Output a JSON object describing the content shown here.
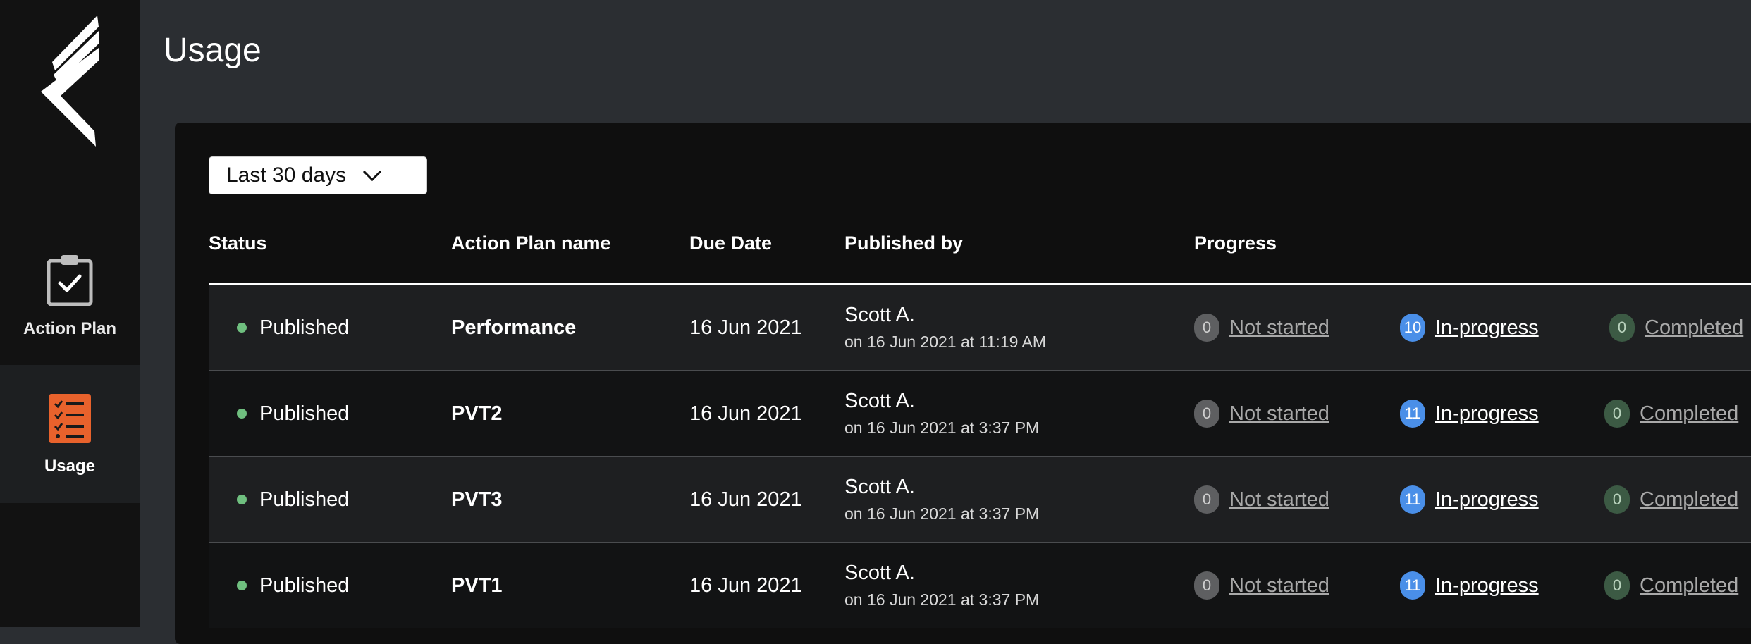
{
  "sidebar": {
    "logo_icon": "brand-logo",
    "items": [
      {
        "label": "Action Plan",
        "icon": "clipboard-check-icon",
        "active": false
      },
      {
        "label": "Usage",
        "icon": "checklist-icon",
        "active": true
      }
    ]
  },
  "header": {
    "title": "Usage"
  },
  "filter": {
    "selected": "Last 30 days"
  },
  "table": {
    "columns": [
      "Status",
      "Action Plan name",
      "Due Date",
      "Published by",
      "Progress"
    ],
    "rows": [
      {
        "status": "Published",
        "name": "Performance",
        "due": "16 Jun 2021",
        "published_by": "Scott A.",
        "published_on": "on 16 Jun 2021 at 11:19 AM",
        "not_started_count": "0",
        "not_started_label": "Not started",
        "in_progress_count": "10",
        "in_progress_label": "In-progress",
        "completed_count": "0",
        "completed_label": "Completed"
      },
      {
        "status": "Published",
        "name": "PVT2",
        "due": "16 Jun 2021",
        "published_by": "Scott A.",
        "published_on": "on 16 Jun 2021 at 3:37 PM",
        "not_started_count": "0",
        "not_started_label": "Not started",
        "in_progress_count": "11",
        "in_progress_label": "In-progress",
        "completed_count": "0",
        "completed_label": "Completed"
      },
      {
        "status": "Published",
        "name": "PVT3",
        "due": "16 Jun 2021",
        "published_by": "Scott A.",
        "published_on": "on 16 Jun 2021 at 3:37 PM",
        "not_started_count": "0",
        "not_started_label": "Not started",
        "in_progress_count": "11",
        "in_progress_label": "In-progress",
        "completed_count": "0",
        "completed_label": "Completed"
      },
      {
        "status": "Published",
        "name": "PVT1",
        "due": "16 Jun 2021",
        "published_by": "Scott A.",
        "published_on": "on 16 Jun 2021 at 3:37 PM",
        "not_started_count": "0",
        "not_started_label": "Not started",
        "in_progress_count": "11",
        "in_progress_label": "In-progress",
        "completed_count": "0",
        "completed_label": "Completed"
      }
    ]
  },
  "colors": {
    "published_dot": "#6fbf7f",
    "in_progress": "#4a8fe8",
    "completed_badge": "#3c5a44",
    "usage_icon": "#e8622c"
  }
}
